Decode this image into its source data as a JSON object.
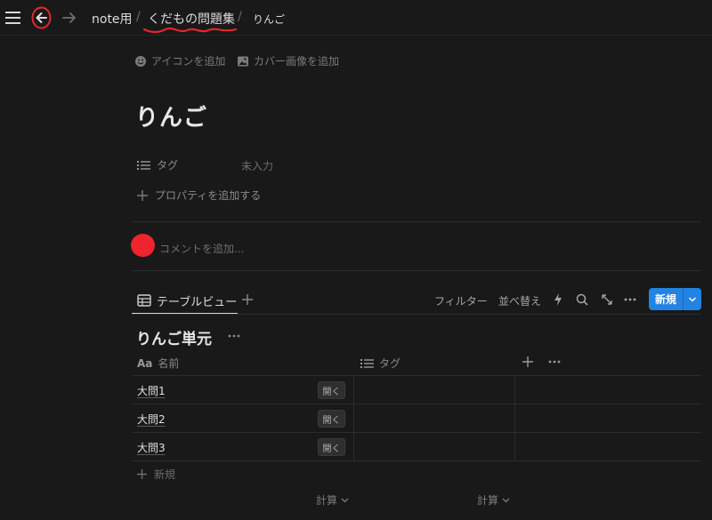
{
  "breadcrumb": {
    "workspace": "note用",
    "parent": "くだもの問題集",
    "current": "りんご",
    "separator": "/"
  },
  "page_hints": {
    "add_icon": "アイコンを追加",
    "add_cover": "カバー画像を追加"
  },
  "page": {
    "title": "りんご"
  },
  "properties": {
    "tag_label": "タグ",
    "tag_value": "未入力",
    "add_property": "プロパティを追加する"
  },
  "comment": {
    "placeholder": "コメントを追加..."
  },
  "database": {
    "view_tab": "テーブルビュー",
    "toolbar": {
      "filter": "フィルター",
      "sort": "並べ替え",
      "new": "新規"
    },
    "title": "りんご単元",
    "columns": {
      "name_prefix": "Aa",
      "name": "名前",
      "tag": "タグ"
    },
    "rows": [
      {
        "name": "大問1",
        "open": "開く"
      },
      {
        "name": "大問2",
        "open": "開く"
      },
      {
        "name": "大問3",
        "open": "開く"
      }
    ],
    "add_row": "新規",
    "calc": [
      "計算",
      "計算"
    ]
  },
  "colors": {
    "background": "#191919",
    "accent_blue": "#2383e2",
    "annotation_red": "#e5252d"
  },
  "icons": [
    "menu-icon",
    "back-arrow-icon",
    "forward-arrow-icon",
    "smiley-icon",
    "image-icon",
    "list-icon",
    "plus-icon",
    "table-icon",
    "lightning-icon",
    "search-icon",
    "expand-icon",
    "more-icon",
    "chevron-down-icon"
  ]
}
